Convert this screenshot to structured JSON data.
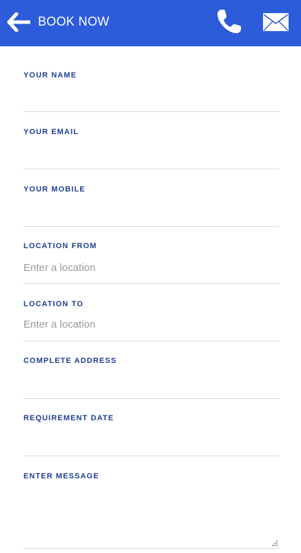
{
  "header": {
    "title": "BOOK NOW",
    "back_icon": "arrow-left-icon",
    "phone_icon": "phone-icon",
    "mail_icon": "mail-icon",
    "background": "#2d5cdb"
  },
  "form": {
    "fields": [
      {
        "label": "YOUR NAME",
        "placeholder": "",
        "value": ""
      },
      {
        "label": "YOUR EMAIL",
        "placeholder": "",
        "value": ""
      },
      {
        "label": "YOUR MOBILE",
        "placeholder": "",
        "value": ""
      },
      {
        "label": "LOCATION FROM",
        "placeholder": "Enter a location",
        "value": ""
      },
      {
        "label": "LOCATION TO",
        "placeholder": "Enter a location",
        "value": ""
      },
      {
        "label": "COMPLETE ADDRESS",
        "placeholder": "",
        "value": ""
      },
      {
        "label": "REQUIREMENT DATE",
        "placeholder": "",
        "value": ""
      },
      {
        "label": "ENTER MESSAGE",
        "placeholder": "",
        "value": ""
      }
    ],
    "label_color": "#1d3f94"
  }
}
